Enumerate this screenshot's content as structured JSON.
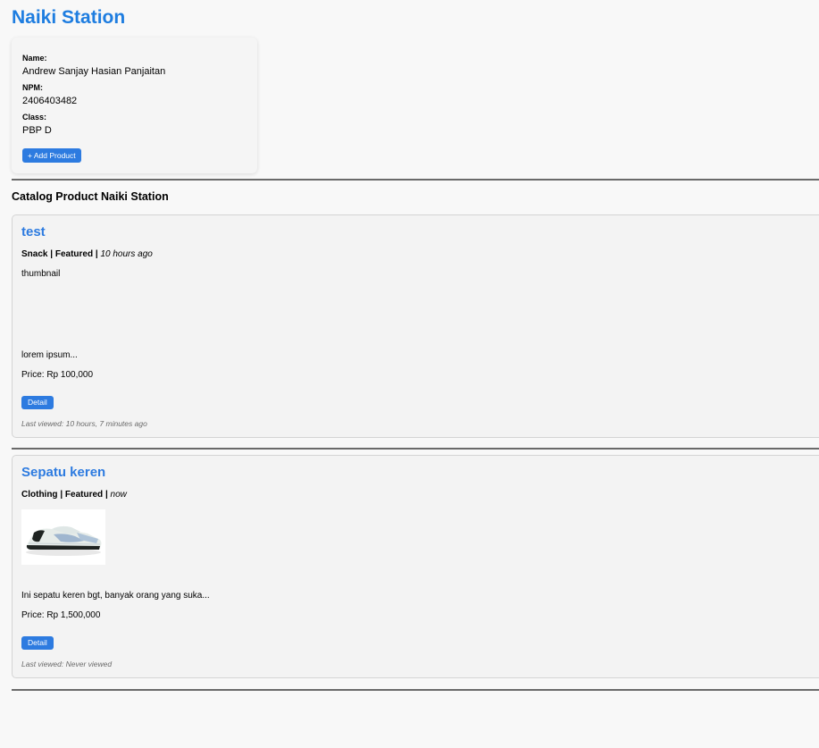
{
  "header": {
    "title": "Naiki Station"
  },
  "profile": {
    "name_label": "Name:",
    "name": "Andrew Sanjay Hasian Panjaitan",
    "npm_label": "NPM:",
    "npm": "2406403482",
    "class_label": "Class:",
    "class": "PBP D",
    "add_button": "+ Add Product"
  },
  "catalog": {
    "heading": "Catalog Product Naiki Station",
    "products": [
      {
        "name": "test",
        "category": "Snack",
        "sep1": "|",
        "featured": "Featured",
        "sep2": "|",
        "time": "10 hours ago",
        "thumbnail_alt": "thumbnail",
        "description": "lorem ipsum...",
        "price": "Price: Rp 100,000",
        "detail_button": "Detail",
        "last_viewed": "Last viewed: 10 hours, 7 minutes ago"
      },
      {
        "name": "Sepatu keren",
        "category": "Clothing",
        "sep1": "|",
        "featured": "Featured",
        "sep2": "|",
        "time": "now",
        "description": "Ini sepatu keren bgt, banyak orang yang suka...",
        "price": "Price: Rp 1,500,000",
        "detail_button": "Detail",
        "last_viewed": "Last viewed: Never viewed"
      }
    ]
  }
}
